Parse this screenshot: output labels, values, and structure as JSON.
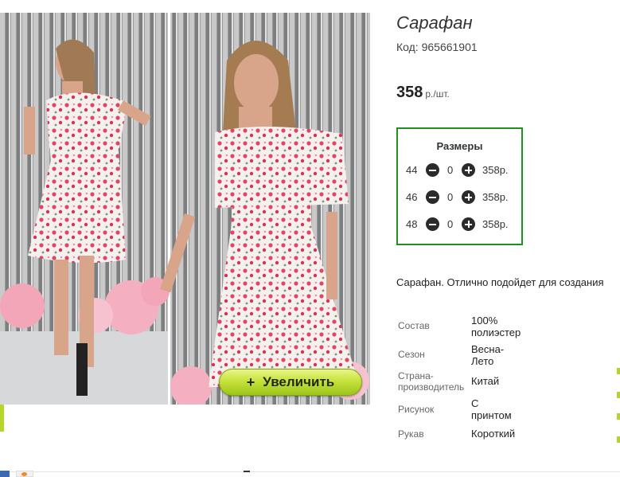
{
  "product": {
    "title": "Сарафан",
    "code": "Код: 965661901",
    "price": "358",
    "price_unit": "р./шт.",
    "zoom_label": "Увеличить",
    "zoom_plus": "+",
    "description": "Сарафан. Отлично подойдет для создания"
  },
  "sizes": {
    "heading": "Размеры",
    "rows": [
      {
        "size": "44",
        "qty": "0",
        "price": "358р."
      },
      {
        "size": "46",
        "qty": "0",
        "price": "358р."
      },
      {
        "size": "48",
        "qty": "0",
        "price": "358р."
      }
    ]
  },
  "properties": [
    {
      "key": "Состав",
      "value": "100% полиэстер"
    },
    {
      "key": "Сезон",
      "value": "Весна-Лето"
    },
    {
      "key": "Страна-производитель",
      "value": "Китай"
    },
    {
      "key": "Рисунок",
      "value": "С принтом"
    },
    {
      "key": "Рукав",
      "value": "Короткий"
    }
  ],
  "colors": {
    "sizes_border": "#1f8f1f",
    "zoom_button": "#c6e23c",
    "dress_print": "#e0455f"
  }
}
